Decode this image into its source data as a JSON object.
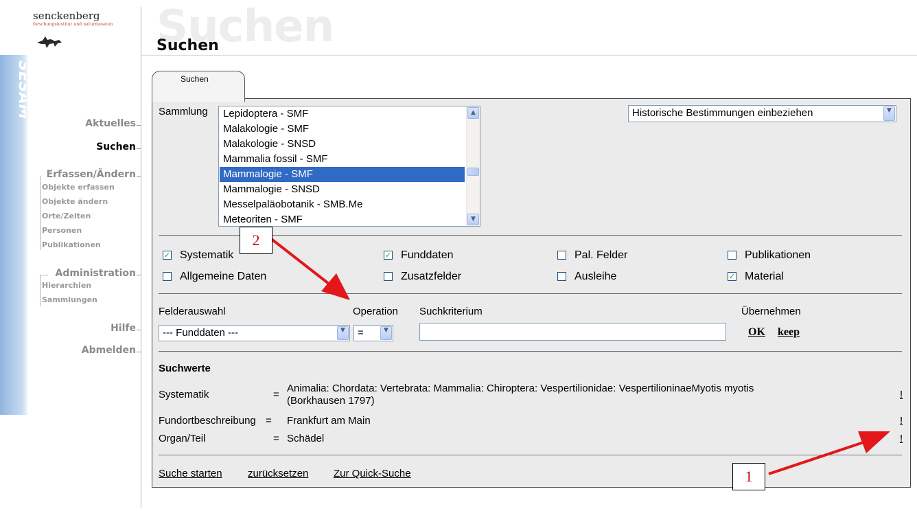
{
  "brand": {
    "name": "senckenberg",
    "subtitle": "forschungsinstitut und naturmuseum",
    "app_name": "SESAM"
  },
  "nav": {
    "aktuelles": "Aktuelles",
    "suchen": "Suchen",
    "erfassen_group": "Erfassen/Ändern",
    "erfassen_items": [
      "Objekte erfassen",
      "Objekte ändern",
      "Orte/Zeiten",
      "Personen",
      "Publikationen"
    ],
    "admin_group": "Administration",
    "admin_items": [
      "Hierarchien",
      "Sammlungen"
    ],
    "hilfe": "Hilfe",
    "abmelden": "Abmelden"
  },
  "header": {
    "ghost_title": "Suchen",
    "title": "Suchen"
  },
  "tab": {
    "label": "Suchen"
  },
  "sammlung": {
    "label": "Sammlung",
    "options": [
      "Lepidoptera - SMF",
      "Malakologie - SMF",
      "Malakologie - SNSD",
      "Mammalia fossil - SMF",
      "Mammalogie - SMF",
      "Mammalogie - SNSD",
      "Messelpaläobotanik - SMB.Me",
      "Meteoriten - SMF"
    ],
    "selected": "Mammalogie - SMF"
  },
  "historic_select": {
    "value": "Historische Bestimmungen einbeziehen"
  },
  "checkboxes": {
    "systematik": {
      "label": "Systematik",
      "checked": true
    },
    "funddaten": {
      "label": "Funddaten",
      "checked": true
    },
    "pal_felder": {
      "label": "Pal. Felder",
      "checked": false
    },
    "publikationen": {
      "label": "Publikationen",
      "checked": false
    },
    "allgemeine_daten": {
      "label": "Allgemeine Daten",
      "checked": false
    },
    "zusatzfelder": {
      "label": "Zusatzfelder",
      "checked": false
    },
    "ausleihe": {
      "label": "Ausleihe",
      "checked": false
    },
    "material": {
      "label": "Material",
      "checked": true
    }
  },
  "criteria": {
    "felderauswahl_label": "Felderauswahl",
    "operation_label": "Operation",
    "suchkriterium_label": "Suchkriterium",
    "uebernehmen_label": "Übernehmen",
    "felderauswahl_value": "--- Funddaten ---",
    "operation_value": "=",
    "suchkriterium_value": "",
    "ok": "OK",
    "keep": "keep"
  },
  "suchwerte": {
    "heading": "Suchwerte",
    "rows": [
      {
        "field": "Systematik",
        "op": "=",
        "value_line1": "Animalia: Chordata: Vertebrata: Mammalia: Chiroptera: Vespertilionidae: VespertilioninaeMyotis myotis",
        "value_line2": "(Borkhausen 1797)",
        "remove": "!"
      },
      {
        "field": "Fundortbeschreibung",
        "op": "=",
        "value_line1": "Frankfurt am Main",
        "value_line2": "",
        "remove": "!"
      },
      {
        "field": "Organ/Teil",
        "op": "=",
        "value_line1": "Schädel",
        "value_line2": "",
        "remove": "!"
      }
    ]
  },
  "footer_links": {
    "start": "Suche starten",
    "reset": "zurücksetzen",
    "quick": "Zur Quick-Suche"
  },
  "annotations": {
    "callout_1": "1",
    "callout_2": "2",
    "arrow_color": "#e3171b"
  },
  "colors": {
    "selection": "#316ac5",
    "panel_bg": "#ebebeb",
    "check_green": "#21a121"
  }
}
